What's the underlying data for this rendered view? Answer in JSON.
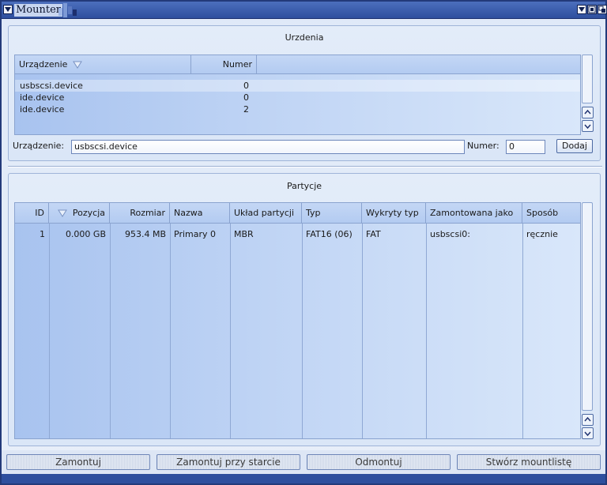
{
  "window": {
    "title": "Mounter"
  },
  "devices": {
    "group_title": "Urzdenia",
    "columns": [
      "Urządzenie",
      "Numer"
    ],
    "rows": [
      {
        "device": "usbscsi.device",
        "number": "0"
      },
      {
        "device": "ide.device",
        "number": "0"
      },
      {
        "device": "ide.device",
        "number": "2"
      }
    ],
    "device_label": "Urządzenie:",
    "device_value": "usbscsi.device",
    "number_label": "Numer:",
    "number_value": "0",
    "add_button": "Dodaj"
  },
  "partitions": {
    "group_title": "Partycje",
    "columns": [
      "ID",
      "Pozycja",
      "Rozmiar",
      "Nazwa",
      "Układ partycji",
      "Typ",
      "Wykryty typ",
      "Zamontowana jako",
      "Sposób"
    ],
    "rows": [
      {
        "id": "1",
        "position": "0.000 GB",
        "size": "953.4 MB",
        "name": "Primary 0",
        "layout": "MBR",
        "type": "FAT16 (06)",
        "detected": "FAT",
        "mounted_as": "usbscsi0:",
        "method": "ręcznie"
      }
    ]
  },
  "actions": {
    "mount": "Zamontuj",
    "mount_at_boot": "Zamontuj przy starcie",
    "unmount": "Odmontuj",
    "create_mountlist": "Stwórz mountlistę"
  }
}
